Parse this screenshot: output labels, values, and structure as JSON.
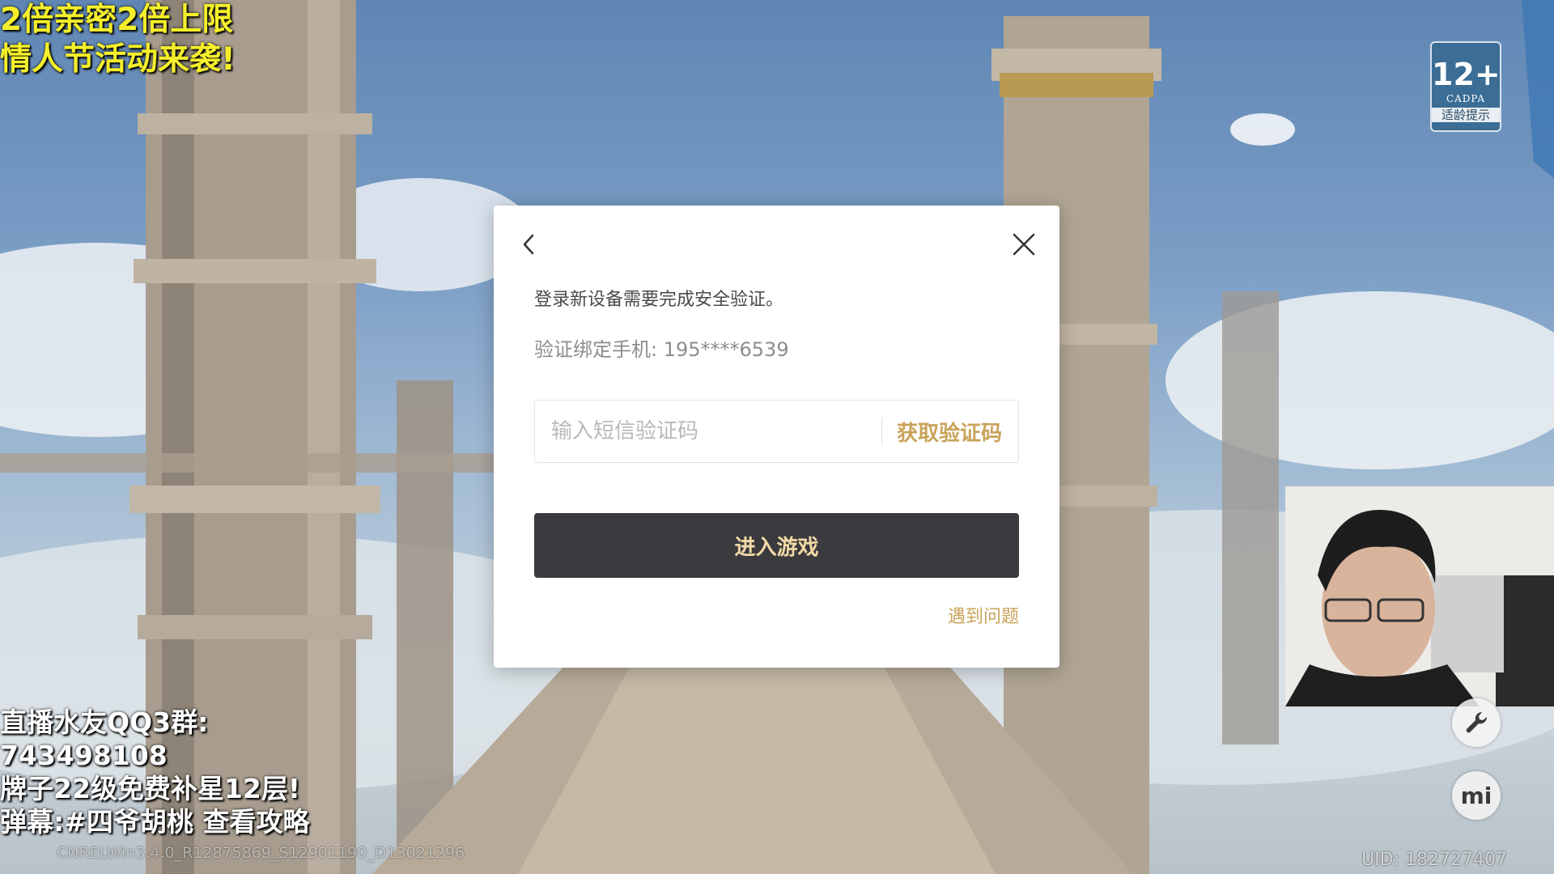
{
  "overlay": {
    "promo_line1": "2倍亲密2倍上限",
    "promo_line2": "情人节活动来袭!",
    "stream_line1": "直播水友QQ3群:",
    "stream_line2": "743498108",
    "stream_line3": "牌子22级免费补星12层!",
    "stream_line4": "弹幕:#四爷胡桃 查看攻略"
  },
  "game": {
    "version": "CNRELWin3.4.0_R12875869_S12901190_D13021296",
    "uid": "UID: 182727407",
    "age_badge": {
      "rating": "12+",
      "org": "CADPA",
      "tip": "适龄提示"
    },
    "side_buttons": [
      {
        "icon": "wrench-icon"
      },
      {
        "icon": "mihoyo-logo-icon",
        "glyph": "mi"
      }
    ]
  },
  "dialog": {
    "message": "登录新设备需要完成安全验证。",
    "phone_label": "验证绑定手机: 195****6539",
    "code_placeholder": "输入短信验证码",
    "get_code_label": "获取验证码",
    "enter_button": "进入游戏",
    "problem_link": "遇到问题",
    "icons": {
      "back": "chevron-left-icon",
      "close": "close-icon"
    }
  },
  "colors": {
    "promo_text": "#f4ef2a",
    "accent_gold": "#c9a35a",
    "enter_button_bg": "#3b3a3e",
    "enter_button_text": "#f1d9a6"
  }
}
